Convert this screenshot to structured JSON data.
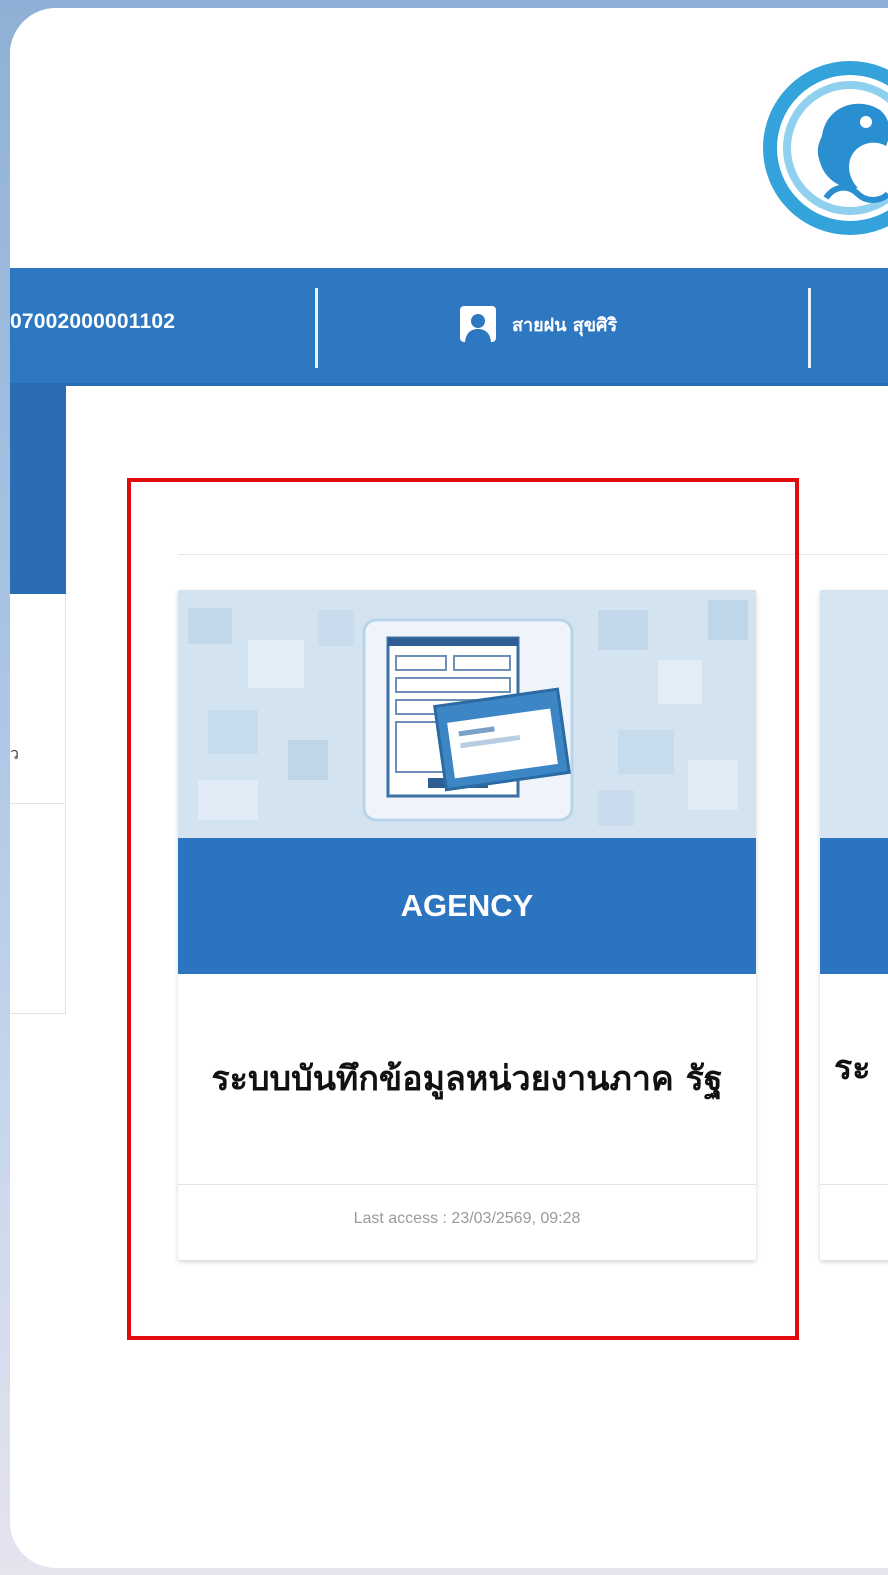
{
  "header": {
    "account_id": "07002000001102",
    "user_name": "สายฝน สุขศิริ"
  },
  "sidebar": {
    "partial_text": "ว"
  },
  "cards": [
    {
      "label": "AGENCY",
      "title": "ระบบบันทึกข้อมูลหน่วยงานภาค รัฐ",
      "last_access": "Last access : 23/03/2569, 09:28"
    },
    {
      "title_partial": "ระ"
    }
  ],
  "colors": {
    "navbar": "#2e78c2",
    "card_label": "#2b74bf",
    "highlight": "#e20b0b"
  },
  "icons": {
    "user": "user-icon",
    "logo": "organization-logo",
    "form": "form-document-icon"
  }
}
